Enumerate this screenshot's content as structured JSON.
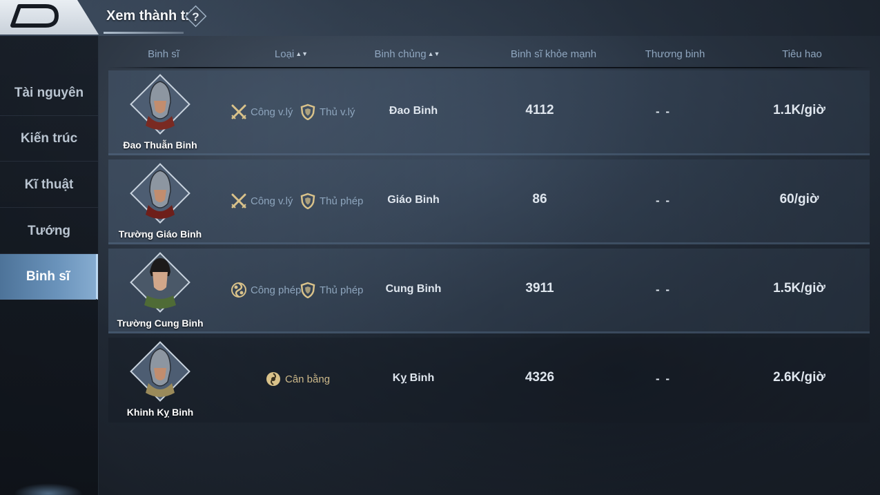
{
  "header": {
    "title": "Xem thành trì",
    "help_symbol": "?"
  },
  "sidebar": {
    "items": [
      {
        "label": "Tài nguyên",
        "active": false
      },
      {
        "label": "Kiến trúc",
        "active": false
      },
      {
        "label": "Kĩ thuật",
        "active": false
      },
      {
        "label": "Tướng",
        "active": false
      },
      {
        "label": "Binh sĩ",
        "active": true
      }
    ]
  },
  "table": {
    "columns": {
      "soldier": "Binh sĩ",
      "type": "Loại",
      "branch": "Binh chủng",
      "healthy": "Binh sĩ khỏe mạnh",
      "wounded": "Thương binh",
      "upkeep": "Tiêu hao"
    },
    "rows": [
      {
        "name": "Đao Thuẫn Binh",
        "tag1": "Công v.lý",
        "tag1_icon": "crossed-swords-icon",
        "tag2": "Thủ v.lý",
        "tag2_icon": "shield-icon",
        "branch": "Đao Binh",
        "healthy": "4112",
        "wounded": "- -",
        "upkeep": "1.1K/giờ"
      },
      {
        "name": "Trường Giáo Binh",
        "tag1": "Công v.lý",
        "tag1_icon": "crossed-swords-icon",
        "tag2": "Thủ phép",
        "tag2_icon": "shield-icon",
        "branch": "Giáo Binh",
        "healthy": "86",
        "wounded": "- -",
        "upkeep": "60/giờ"
      },
      {
        "name": "Trường Cung Binh",
        "tag1": "Công phép",
        "tag1_icon": "magic-swirl-icon",
        "tag2": "Thủ phép",
        "tag2_icon": "shield-icon",
        "branch": "Cung Binh",
        "healthy": "3911",
        "wounded": "- -",
        "upkeep": "1.5K/giờ"
      },
      {
        "name": "Khinh Kỵ Binh",
        "tag1": "Cân bằng",
        "tag1_icon": "balance-icon",
        "branch": "Kỵ Binh",
        "healthy": "4326",
        "wounded": "- -",
        "upkeep": "2.6K/giờ"
      }
    ]
  },
  "colors": {
    "accent": "#6a93bb",
    "gold": "#d9c28a",
    "muted": "#8ea5bd"
  }
}
